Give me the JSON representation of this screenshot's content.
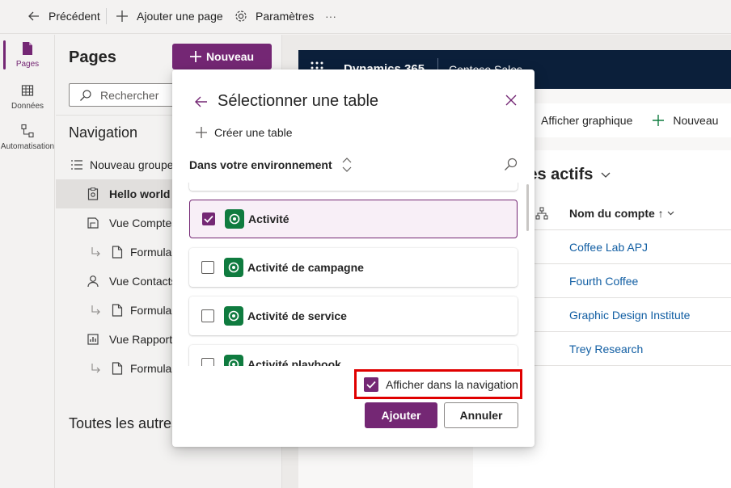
{
  "toolbar": {
    "back_label": "Précédent",
    "add_page_label": "Ajouter une page",
    "settings_label": "Paramètres",
    "more_label": "···"
  },
  "rail": {
    "items": [
      {
        "label": "Pages",
        "icon": "page-icon",
        "selected": true
      },
      {
        "label": "Données",
        "icon": "table-icon",
        "selected": false
      },
      {
        "label": "Automatisation",
        "icon": "flow-icon",
        "selected": false
      }
    ]
  },
  "pages_panel": {
    "title": "Pages",
    "new_button": "Nouveau",
    "search_placeholder": "Rechercher",
    "navigation_title": "Navigation",
    "nav_items": [
      {
        "label": "Nouveau groupe",
        "icon": "group-list-icon"
      },
      {
        "label": "Hello world",
        "icon": "custom-page-icon",
        "selected": true
      },
      {
        "label": "Vue Comptes",
        "icon": "view-icon"
      },
      {
        "label": "Formulaires",
        "icon": "form-icon"
      },
      {
        "label": "Vue Contacts",
        "icon": "person-icon"
      },
      {
        "label": "Formulaires",
        "icon": "form-icon"
      },
      {
        "label": "Vue Rapports",
        "icon": "report-icon"
      },
      {
        "label": "Formulaires",
        "icon": "form-icon"
      }
    ],
    "all_other_title": "Toutes les autres pages"
  },
  "preview": {
    "app_name": "Dynamics 365",
    "app_sub": "Contoso Sales",
    "cmd_chart": "Afficher graphique",
    "cmd_new": "Nouveau",
    "view_title": "Comptes actifs",
    "column_header": "Nom du compte ↑",
    "rows": [
      "Coffee Lab APJ",
      "Fourth Coffee",
      "Graphic Design Institute",
      "Trey Research"
    ]
  },
  "dialog": {
    "title": "Sélectionner une table",
    "create_table": "Créer une table",
    "environment_label": "Dans votre environnement",
    "tables": [
      {
        "name": "Activité",
        "checked": true
      },
      {
        "name": "Activité de campagne",
        "checked": false
      },
      {
        "name": "Activité de service",
        "checked": false
      },
      {
        "name": "Activité playbook",
        "checked": false
      }
    ],
    "show_in_nav_label": "Afficher dans la navigation",
    "show_in_nav_checked": true,
    "add_button": "Ajouter",
    "cancel_button": "Annuler"
  },
  "colors": {
    "accent": "#742774",
    "table_icon": "#0f7b3f",
    "highlight": "#e00000",
    "link": "#115ea3"
  }
}
